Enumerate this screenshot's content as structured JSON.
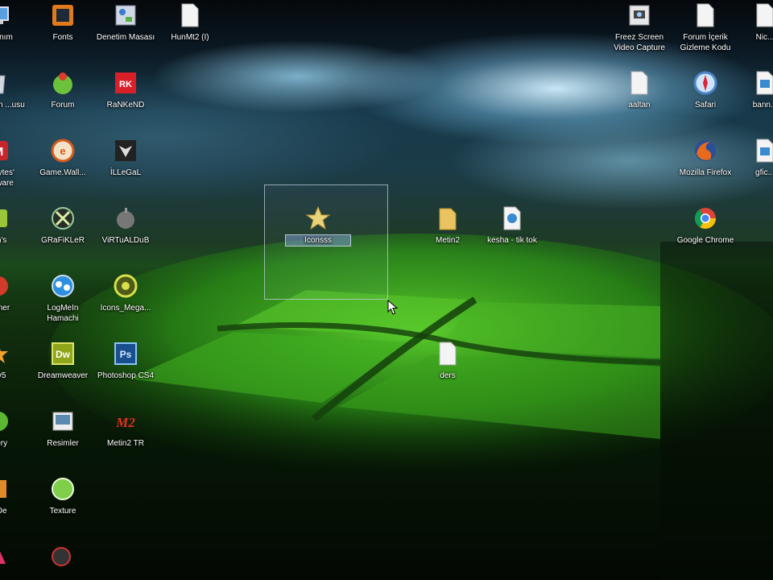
{
  "desktop": {
    "icons": [
      {
        "label": "...yanım",
        "icon": "monitor-icon"
      },
      {
        "label": "Fonts",
        "icon": "fonts-folder-icon"
      },
      {
        "label": "Denetim Masası",
        "icon": "control-panel-icon"
      },
      {
        "label": "HunMt2 (I)",
        "icon": "blank-file-icon"
      },
      {
        "label": "...nüşüm ...usu",
        "icon": "recycle-bin-icon"
      },
      {
        "label": "Forum",
        "icon": "forum-icon"
      },
      {
        "label": "RaNKeND",
        "icon": "rankend-icon"
      },
      {
        "label": "...ebytes' ...alware",
        "icon": "malwarebytes-icon"
      },
      {
        "label": "Game.Wall...",
        "icon": "game-wallpaper-icon"
      },
      {
        "label": "İLLeGaL",
        "icon": "illegal-icon"
      },
      {
        "label": "...n's",
        "icon": "app-icon"
      },
      {
        "label": "GRaFiKLeR",
        "icon": "graphics-icon"
      },
      {
        "label": "ViRTuALDuB",
        "icon": "apple-icon"
      },
      {
        "label": "...aner",
        "icon": "app-icon"
      },
      {
        "label": "LogMeIn Hamachi",
        "icon": "hamachi-icon"
      },
      {
        "label": "Icons_Mega...",
        "icon": "icons-mega-icon"
      },
      {
        "label": "...v5",
        "icon": "app-icon"
      },
      {
        "label": "Dreamweaver",
        "icon": "dreamweaver-icon"
      },
      {
        "label": "Photoshop CS4",
        "icon": "photoshop-icon"
      },
      {
        "label": "...ery",
        "icon": "app-icon"
      },
      {
        "label": "Resimler",
        "icon": "pictures-icon"
      },
      {
        "label": "Metin2 TR",
        "icon": "metin2-icon"
      },
      {
        "label": "...De",
        "icon": "app-icon"
      },
      {
        "label": "Texture",
        "icon": "texture-icon"
      },
      {
        "label": "Iconsss",
        "icon": "star-icon",
        "selected": true
      },
      {
        "label": "Metin2",
        "icon": "folder-icon"
      },
      {
        "label": "kesha - tik tok",
        "icon": "media-file-icon"
      },
      {
        "label": "ders",
        "icon": "blank-file-icon"
      },
      {
        "label": "Freez Screen Video Capture",
        "icon": "screen-capture-icon"
      },
      {
        "label": "Forum İçerik Gizleme Kodu",
        "icon": "blank-file-icon"
      },
      {
        "label": "Nic...",
        "icon": "blank-file-icon"
      },
      {
        "label": "aaltan",
        "icon": "blank-file-icon"
      },
      {
        "label": "Safari",
        "icon": "safari-icon"
      },
      {
        "label": "bann...",
        "icon": "image-file-icon"
      },
      {
        "label": "Mozilla Firefox",
        "icon": "firefox-icon"
      },
      {
        "label": "gfic...",
        "icon": "image-file-icon"
      },
      {
        "label": "Google Chrome",
        "icon": "chrome-icon"
      }
    ]
  }
}
